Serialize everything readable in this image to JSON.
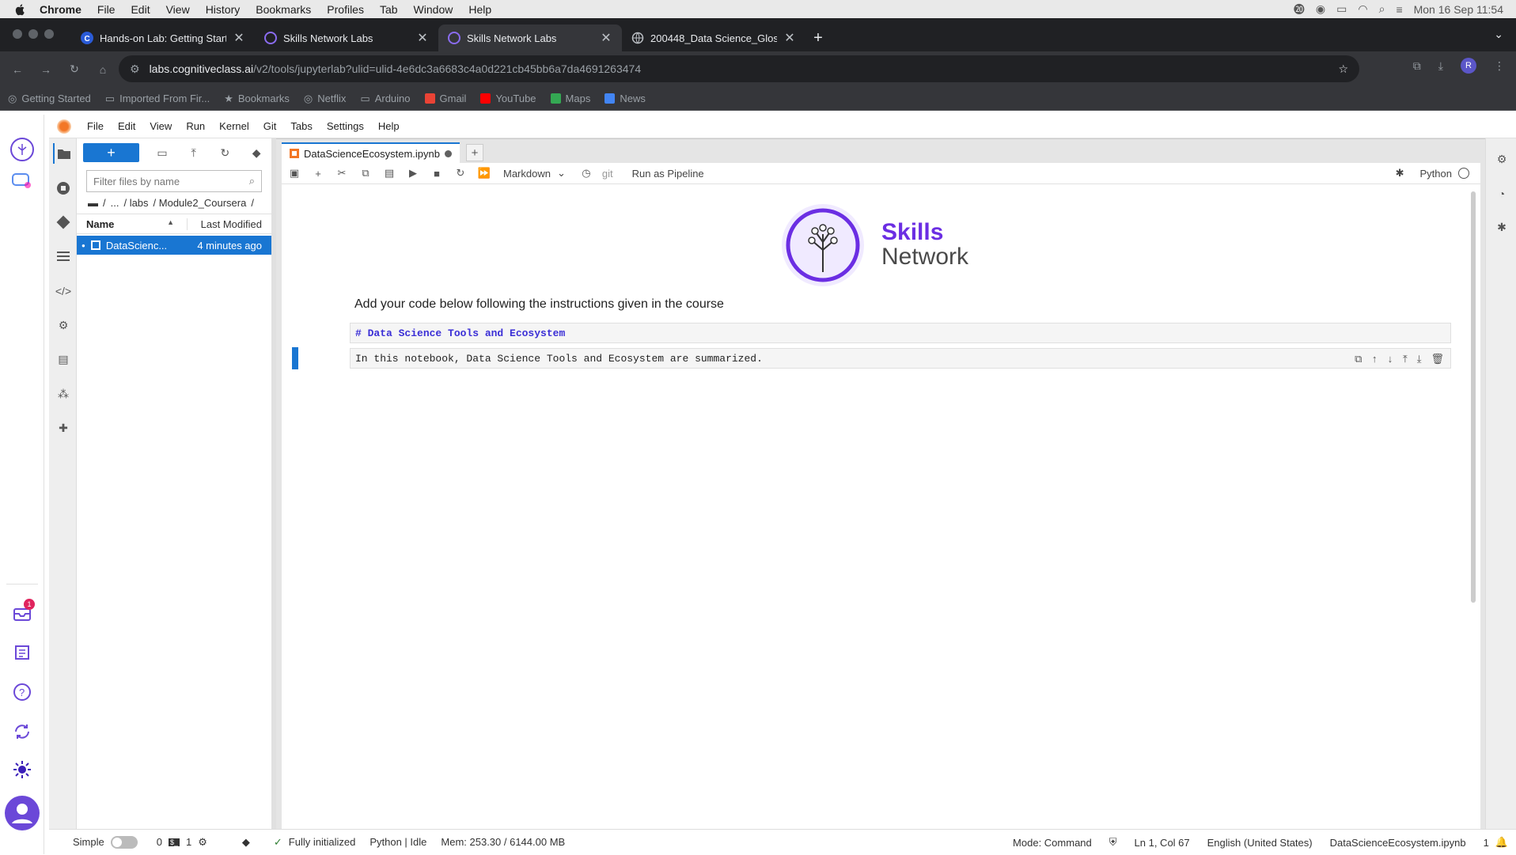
{
  "mac_menu": {
    "app": "Chrome",
    "items": [
      "File",
      "Edit",
      "View",
      "History",
      "Bookmarks",
      "Profiles",
      "Tab",
      "Window",
      "Help"
    ],
    "clock": "Mon 16 Sep  11:54"
  },
  "browser": {
    "tabs": [
      {
        "title": "Hands-on Lab: Getting Starte",
        "active": false
      },
      {
        "title": "Skills Network Labs",
        "active": false
      },
      {
        "title": "Skills Network Labs",
        "active": true
      },
      {
        "title": "200448_Data Science_Gloss",
        "active": false
      }
    ],
    "url_host": "labs.cognitiveclass.ai",
    "url_path": "/v2/tools/jupyterlab?ulid=ulid-4e6dc3a6683c4a0d221cb45bb6a7da4691263474",
    "profile_initial": "R",
    "bookmarks": [
      "Getting Started",
      "Imported From Fir...",
      "Bookmarks",
      "Netflix",
      "Arduino",
      "Gmail",
      "YouTube",
      "Maps",
      "News"
    ]
  },
  "skills_sidebar": {
    "notification_count": "1"
  },
  "jupyter": {
    "menu": [
      "File",
      "Edit",
      "View",
      "Run",
      "Kernel",
      "Git",
      "Tabs",
      "Settings",
      "Help"
    ],
    "file_browser": {
      "new_label": "+",
      "filter_placeholder": "Filter files by name",
      "breadcrumb": [
        "/",
        "...",
        "/ labs",
        "/ Module2_Coursera",
        "/"
      ],
      "col_name": "Name",
      "col_modified": "Last Modified",
      "files": [
        {
          "name": "DataScienc...",
          "modified": "4 minutes ago"
        }
      ]
    },
    "doc_tab": {
      "title": "DataScienceEcosystem.ipynb"
    },
    "toolbar": {
      "cell_type": "Markdown",
      "git": "git",
      "pipeline": "Run as Pipeline",
      "kernel": "Python"
    },
    "notebook": {
      "logo_line1": "Skills",
      "logo_line2": "Network",
      "instruction": "Add your code below following the instructions given in the course",
      "cell1": "# Data Science Tools and Ecosystem",
      "cell2": "In this notebook, Data Science Tools and Ecosystem are summarized."
    },
    "status": {
      "mode_label": "Simple",
      "count0": "0",
      "count1": "1",
      "init": "Fully initialized",
      "kernel": "Python | Idle",
      "mem": "Mem: 253.30 / 6144.00 MB",
      "cmd_mode": "Mode: Command",
      "position": "Ln 1, Col 67",
      "language": "English (United States)",
      "file": "DataScienceEcosystem.ipynb",
      "notif": "1"
    }
  },
  "colors": {
    "accent": "#1976d2",
    "brand": "#6b2ee3",
    "chrome_dark": "#202124"
  }
}
